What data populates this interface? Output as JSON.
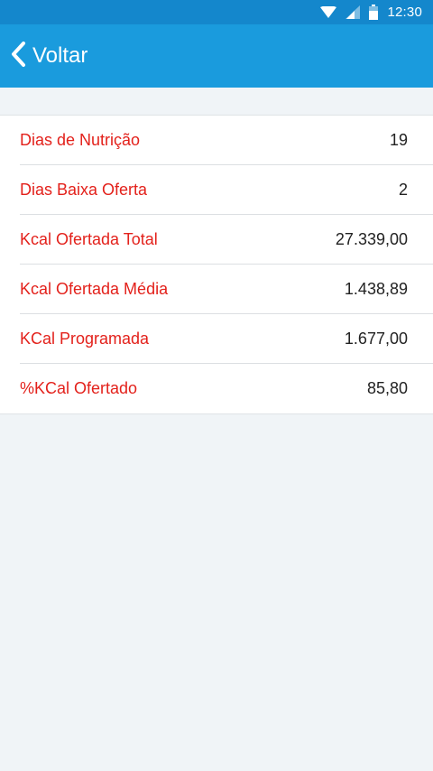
{
  "status_bar": {
    "time": "12:30",
    "icons": [
      "wifi-icon",
      "signal-icon",
      "battery-icon"
    ]
  },
  "nav": {
    "back_label": "Voltar",
    "back_icon": "chevron-left-icon"
  },
  "colors": {
    "status_bar": "#1487cc",
    "nav_bar": "#1a9bdd",
    "label_red": "#e3211b",
    "background": "#f0f4f7"
  },
  "rows": [
    {
      "label": "Dias de Nutrição",
      "value": "19"
    },
    {
      "label": "Dias Baixa Oferta",
      "value": "2"
    },
    {
      "label": "Kcal Ofertada Total",
      "value": "27.339,00"
    },
    {
      "label": "Kcal Ofertada Média",
      "value": "1.438,89"
    },
    {
      "label": "KCal Programada",
      "value": "1.677,00"
    },
    {
      "label": "%KCal Ofertado",
      "value": "85,80"
    }
  ]
}
